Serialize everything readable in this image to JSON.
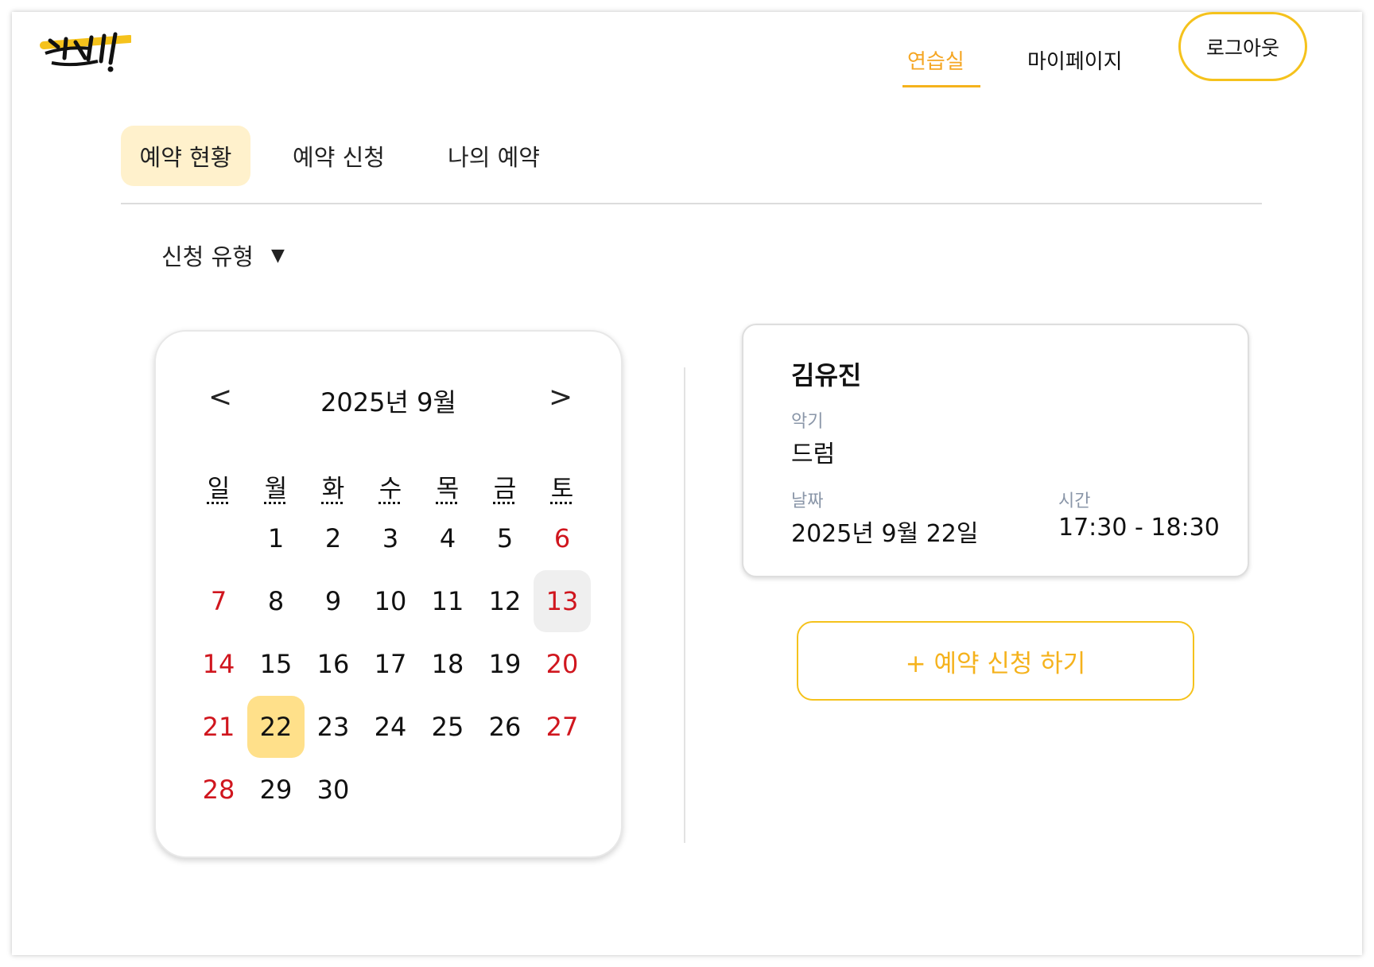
{
  "header": {
    "logo_text": "쏜소!",
    "nav": [
      {
        "label": "연습실",
        "active": true
      },
      {
        "label": "마이페이지",
        "active": false
      }
    ],
    "logout_label": "로그아웃"
  },
  "tabs": [
    {
      "label": "예약 현황",
      "active": true
    },
    {
      "label": "예약 신청",
      "active": false
    },
    {
      "label": "나의 예약",
      "active": false
    }
  ],
  "filter": {
    "label": "신청 유형",
    "caret": "▼"
  },
  "calendar": {
    "title": "2025년 9월",
    "prev": "<",
    "next": ">",
    "weekdays": [
      "일",
      "월",
      "화",
      "수",
      "목",
      "금",
      "토"
    ],
    "start_weekday": 1,
    "days_in_month": 30,
    "today": 13,
    "selected": 22,
    "weekend_color": "#d0161e",
    "selected_color": "#ffe08a"
  },
  "reservation": {
    "name": "김유진",
    "instrument_label": "악기",
    "instrument": "드럼",
    "date_label": "날짜",
    "date": "2025년 9월 22일",
    "time_label": "시간",
    "time": "17:30 - 18:30"
  },
  "apply_button": "+ 예약 신청 하기",
  "colors": {
    "accent": "#f5b21c",
    "tab_active_bg": "#fff1cc"
  }
}
